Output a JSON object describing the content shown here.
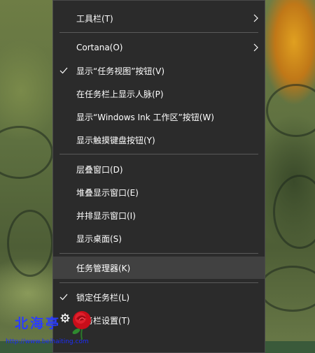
{
  "menu": {
    "items": [
      {
        "label": "工具栏(T)",
        "submenu": true,
        "checked": false
      },
      {
        "label": "Cortana(O)",
        "submenu": true,
        "checked": false
      },
      {
        "label": "显示“任务视图”按钮(V)",
        "submenu": false,
        "checked": true
      },
      {
        "label": "在任务栏上显示人脉(P)",
        "submenu": false,
        "checked": false
      },
      {
        "label": "显示“Windows Ink 工作区”按钮(W)",
        "submenu": false,
        "checked": false
      },
      {
        "label": "显示触摸键盘按钮(Y)",
        "submenu": false,
        "checked": false
      },
      {
        "label": "层叠窗口(D)",
        "submenu": false,
        "checked": false
      },
      {
        "label": "堆叠显示窗口(E)",
        "submenu": false,
        "checked": false
      },
      {
        "label": "并排显示窗口(I)",
        "submenu": false,
        "checked": false
      },
      {
        "label": "显示桌面(S)",
        "submenu": false,
        "checked": false
      },
      {
        "label": "任务管理器(K)",
        "submenu": false,
        "checked": false,
        "highlighted": true
      },
      {
        "label": "锁定任务栏(L)",
        "submenu": false,
        "checked": true
      },
      {
        "label": "任务栏设置(T)",
        "submenu": false,
        "checked": false,
        "icon": "gear-icon"
      }
    ]
  },
  "watermark": {
    "title": "北海亭",
    "url": "http://www.beihaiting.com"
  },
  "colors": {
    "menu_bg": "#2b2b2b",
    "highlight_bg": "#414141",
    "separator": "#5a5a5a",
    "text": "#ffffff",
    "watermark": "#2a3cff"
  }
}
